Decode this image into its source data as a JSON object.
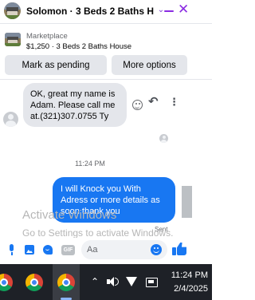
{
  "header": {
    "title": "Solomon · 3 Beds 2 Baths House",
    "chevron_icon": "chevron-down-icon",
    "minimize_icon": "minimize-icon",
    "close_icon": "close-icon"
  },
  "listing": {
    "label": "Marketplace",
    "price_title": "$1,250 · 3 Beds 2 Baths House"
  },
  "actions": {
    "mark_pending": "Mark as pending",
    "more_options": "More options"
  },
  "messages": [
    {
      "direction": "incoming",
      "text": "OK, great my name is Adam. Please call me at.(321)307.0755 Ty"
    },
    {
      "direction": "outgoing",
      "text": "I will Knock you With Adress or more details  as soon thank you",
      "status": "Sent"
    }
  ],
  "timestamp": "11:24 PM",
  "watermark": {
    "line1": "Activate Windows",
    "line2": "Go to Settings to activate Windows."
  },
  "composer": {
    "placeholder": "Aa",
    "gif_label": "GIF"
  },
  "taskbar": {
    "time": "11:24 PM",
    "date": "2/4/2025"
  },
  "colors": {
    "accent": "#1877f2",
    "header_icons": "#8a2be2",
    "taskbar": "#1e2127"
  }
}
